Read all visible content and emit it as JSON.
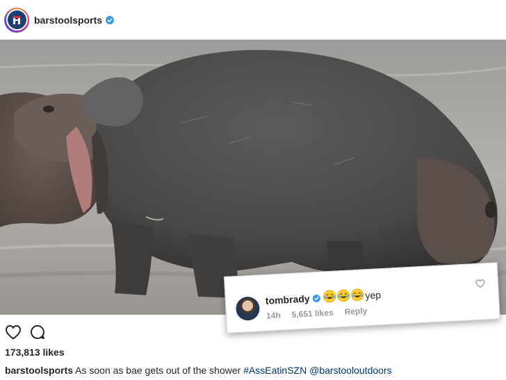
{
  "post": {
    "username": "barstoolsports",
    "likes": "173,813 likes",
    "caption": {
      "user": "barstoolsports",
      "text": "As soon as bae gets out of the shower",
      "hashtag": "#AssEatinSZN",
      "mention": "@barstooloutdoors"
    }
  },
  "icons": {
    "avatar": "barstool-logo-icon",
    "verified": "verified-badge-icon",
    "like": "heart-outline-icon",
    "comment": "comment-bubble-icon",
    "comment_like": "small-heart-icon",
    "emoji": "laughing-tears-emoji-icon"
  },
  "comment": {
    "username": "tombrady",
    "emojis": [
      "😂",
      "😂",
      "😂"
    ],
    "text": "yep",
    "time": "14h",
    "likes": "5,651 likes",
    "reply": "Reply"
  },
  "colors": {
    "verified_blue": "#3897f0",
    "link_blue": "#003569",
    "secondary_text": "#999999"
  }
}
